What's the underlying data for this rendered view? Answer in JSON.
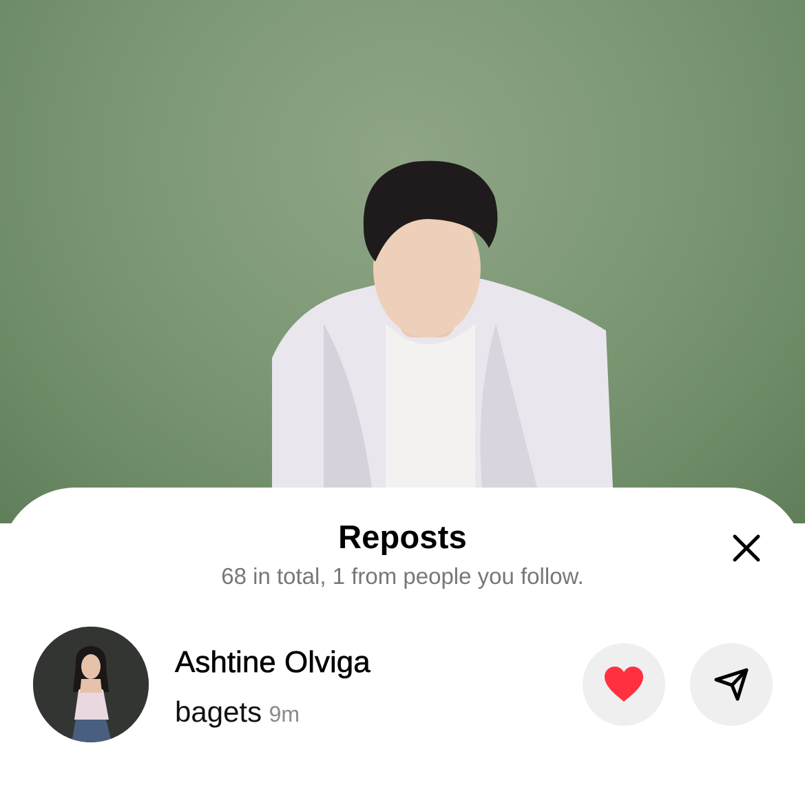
{
  "background_photo": {
    "description_icon": "person-photo",
    "bg_color": "#7f9a77"
  },
  "sheet": {
    "title": "Reposts",
    "subtitle": "68 in total, 1 from people you follow.",
    "close_icon": "close-icon"
  },
  "reposts": [
    {
      "name": "Ashtine Olviga",
      "comment": "bagets",
      "time": "9m",
      "liked": true,
      "like_color": "#ff3040"
    }
  ]
}
